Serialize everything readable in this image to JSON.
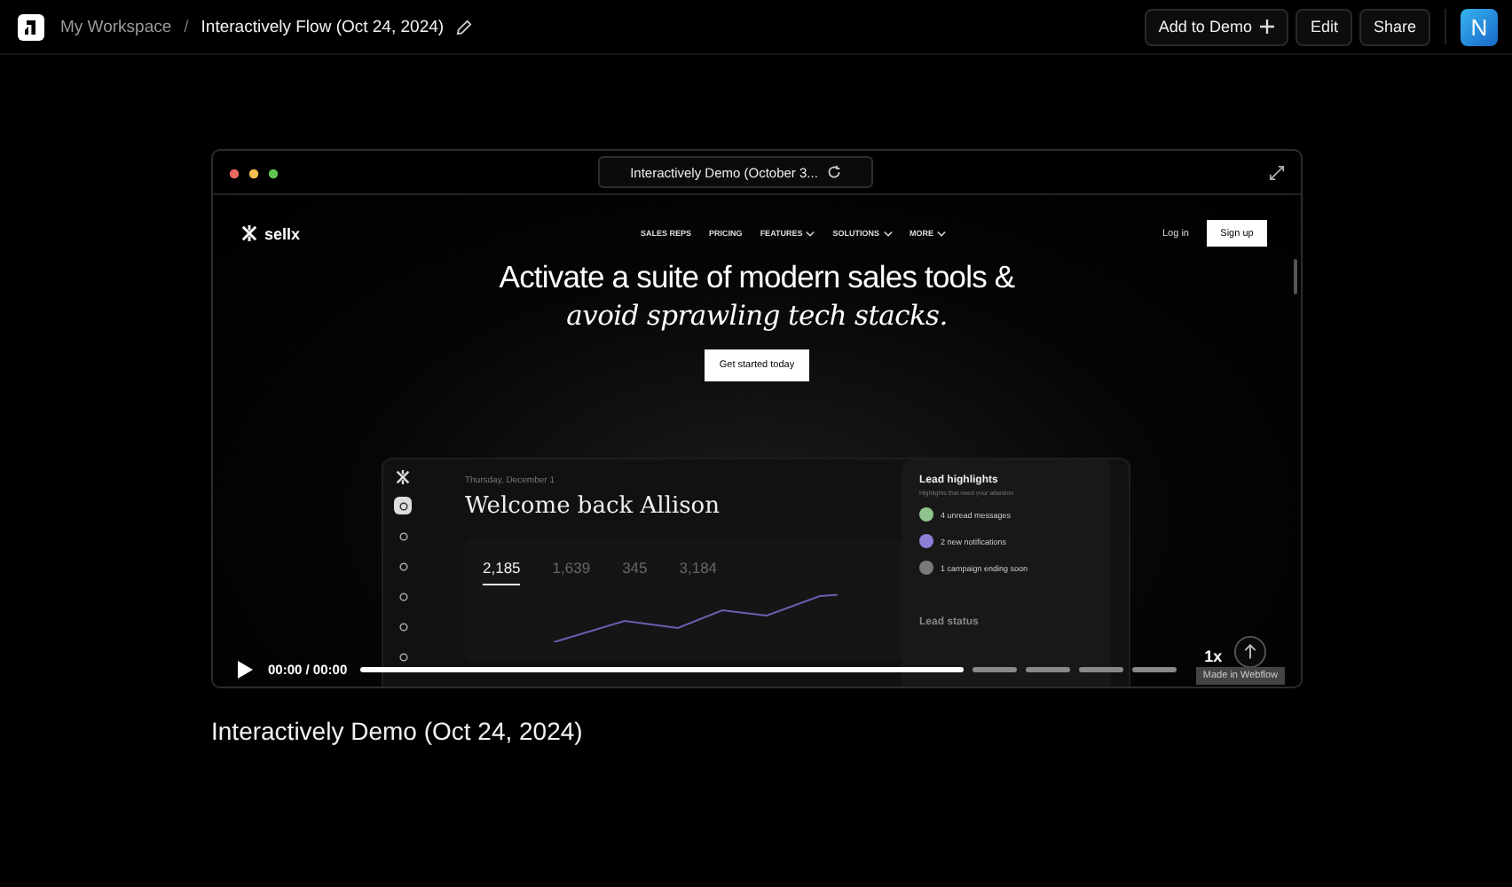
{
  "topbar": {
    "breadcrumb": [
      {
        "label": "My Workspace",
        "current": false
      },
      {
        "label": "Interactively Flow (Oct 24, 2024)",
        "current": true
      }
    ],
    "separator": "/",
    "buttons": [
      {
        "label": "Add to Demo",
        "trailing_plus": true
      },
      {
        "label": "Edit",
        "trailing_plus": false
      },
      {
        "label": "Share",
        "trailing_plus": false
      }
    ],
    "avatar": "N"
  },
  "player": {
    "address": "Interactively Demo (October 3...",
    "site": {
      "logo": "sellx",
      "nav": [
        {
          "label": "SALES REPS",
          "dropdown": false
        },
        {
          "label": "PRICING",
          "dropdown": false
        },
        {
          "label": "FEATURES",
          "dropdown": true
        },
        {
          "label": "SOLUTIONS",
          "dropdown": true
        },
        {
          "label": "MORE",
          "dropdown": true
        }
      ],
      "login": "Log in",
      "signup": "Sign up",
      "headline": "Activate a suite of modern sales tools &",
      "headline_emphasis": "avoid sprawling tech stacks.",
      "cta": "Get started today",
      "dashboard": {
        "sidebar": [
          {
            "selected": true
          },
          {
            "selected": false
          },
          {
            "selected": false
          },
          {
            "selected": false
          },
          {
            "selected": false
          },
          {
            "selected": false
          }
        ],
        "date": "Thursday, December 1",
        "greeting": "Welcome back Allison",
        "stats": [
          {
            "value": "2,185",
            "selected": true
          },
          {
            "value": "1,639",
            "selected": false
          },
          {
            "value": "345",
            "selected": false
          },
          {
            "value": "3,184",
            "selected": false
          }
        ],
        "highlights_title": "Lead highlights",
        "highlights_subtitle": "Highlights that need your attention",
        "highlights": [
          {
            "label": "4 unread messages",
            "color": "#8fc48f"
          },
          {
            "label": "2 new notifications",
            "color": "#8b7fd8"
          },
          {
            "label": "1 campaign ending soon",
            "color": "#7a7a7a"
          }
        ],
        "status_title": "Lead status"
      }
    },
    "controls": {
      "time": "00:00 / 00:00",
      "segments": [
        {
          "level": 1
        },
        {
          "level": 0
        },
        {
          "level": 0
        },
        {
          "level": 0
        },
        {
          "level": 0
        }
      ],
      "speed": "1x"
    },
    "badge": "Made in Webflow"
  },
  "demo_title": "Interactively Demo (Oct 24, 2024)"
}
